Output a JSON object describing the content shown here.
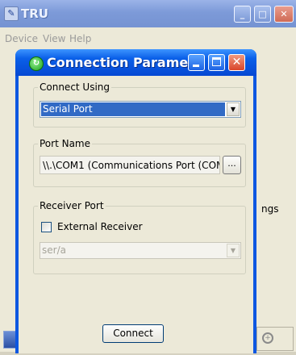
{
  "background_window": {
    "title": "TRU",
    "menu": [
      "Device",
      "View",
      "Help"
    ],
    "fragment_text": "ngs"
  },
  "dialog": {
    "title": "Connection Parame...",
    "connect_using": {
      "label": "Connect Using",
      "value": "Serial Port"
    },
    "port_name": {
      "label": "Port Name",
      "value": "\\\\.\\COM1 (Communications Port (COM",
      "browse_label": "..."
    },
    "receiver_port": {
      "label": "Receiver Port",
      "checkbox_label": "External Receiver",
      "checked": false,
      "value": "ser/a"
    },
    "connect_button": "Connect"
  },
  "colors": {
    "dialog_title_blue": "#0a5fe8",
    "selection_blue": "#316ac5",
    "close_red": "#d9452b"
  }
}
